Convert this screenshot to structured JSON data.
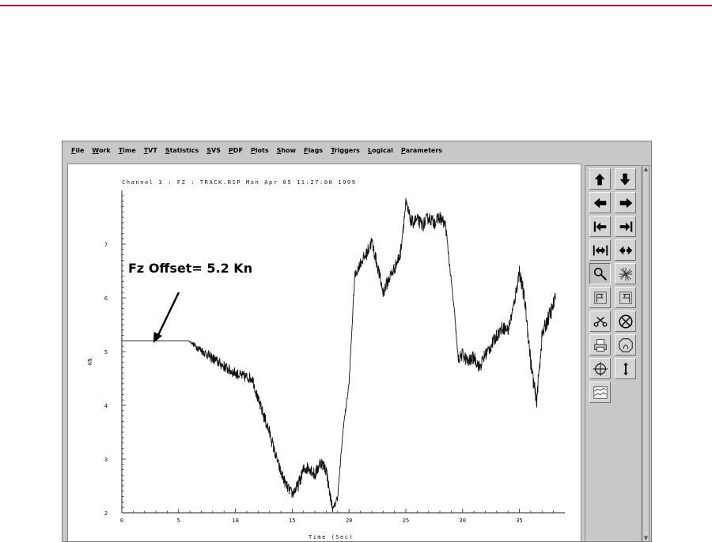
{
  "menu": {
    "items": [
      "File",
      "Work",
      "Time",
      "TVT",
      "Statistics",
      "SVS",
      "PDF",
      "Plots",
      "Show",
      "Flags",
      "Triggers",
      "Logical",
      "Parameters"
    ]
  },
  "plot": {
    "title": "Channel 3 : FZ : TRACK.RSP Mon Apr 05 11:27:00 1999",
    "annotation": "Fz Offset= 5.2 Kn",
    "xlabel": "Time (Sec)",
    "ylabel": "KN"
  },
  "chart_data": {
    "type": "line",
    "title": "Channel 3 : FZ : TRACK.RSP Mon Apr 05 11:27:00 1999",
    "xlabel": "Time (Sec)",
    "ylabel": "KN",
    "xlim": [
      0,
      39
    ],
    "ylim": [
      2,
      8
    ],
    "x_ticks": [
      "0",
      "5",
      "10",
      "15",
      "20",
      "25",
      "30",
      "35"
    ],
    "y_ticks": [
      "2",
      "3",
      "4",
      "5",
      "6",
      "7"
    ],
    "annotation": {
      "text": "Fz Offset= 5.2 Kn",
      "points_to": {
        "x": 1.8,
        "y": 5.2
      }
    },
    "series": [
      {
        "x": [
          0,
          2,
          4,
          5.9,
          6.5,
          7.5,
          8.5,
          9.5,
          10.5,
          11.5,
          12,
          12.5,
          13,
          13.5,
          14,
          14.5,
          15,
          15.5,
          16,
          16.5,
          17,
          17.5,
          18,
          18.3,
          18.6,
          19,
          19.5,
          20,
          20.5,
          21,
          21.5,
          22,
          22.5,
          23,
          23.5,
          24,
          24.5,
          25,
          25.5,
          26,
          26.5,
          27,
          27.5,
          28,
          28.5,
          29,
          29.3,
          29.6,
          30,
          30.5,
          31,
          31.5,
          32,
          32.5,
          33,
          33.5,
          34,
          34.5,
          35,
          35.5,
          36,
          36.5,
          37,
          37.4,
          37.8,
          38.2
        ],
        "y": [
          5.2,
          5.2,
          5.2,
          5.2,
          5.1,
          4.95,
          4.8,
          4.65,
          4.55,
          4.5,
          4.1,
          3.8,
          3.5,
          3.1,
          2.75,
          2.5,
          2.35,
          2.5,
          2.8,
          2.85,
          2.7,
          2.95,
          2.8,
          2.35,
          2.05,
          2.3,
          3.6,
          4.4,
          6.4,
          6.65,
          6.8,
          7.05,
          6.6,
          6.1,
          6.35,
          6.55,
          6.8,
          7.75,
          7.4,
          7.45,
          7.35,
          7.5,
          7.4,
          7.5,
          7.35,
          6.3,
          5.7,
          4.85,
          4.95,
          4.8,
          4.9,
          4.7,
          4.95,
          5.1,
          5.3,
          5.45,
          5.4,
          5.85,
          6.5,
          5.9,
          4.8,
          4.05,
          5.3,
          5.55,
          5.75,
          6.0
        ],
        "noise": [
          0,
          0,
          0,
          0,
          0.06,
          0.09,
          0.1,
          0.1,
          0.1,
          0.1,
          0.1,
          0.12,
          0.12,
          0.1,
          0.1,
          0.1,
          0.1,
          0.12,
          0.12,
          0.12,
          0.12,
          0.12,
          0.12,
          0.1,
          0.08,
          0.06,
          0.05,
          0.05,
          0.08,
          0.1,
          0.12,
          0.12,
          0.12,
          0.12,
          0.12,
          0.12,
          0.12,
          0.12,
          0.12,
          0.12,
          0.12,
          0.12,
          0.12,
          0.12,
          0.1,
          0.06,
          0.04,
          0.1,
          0.12,
          0.12,
          0.12,
          0.12,
          0.12,
          0.12,
          0.12,
          0.12,
          0.12,
          0.12,
          0.15,
          0.15,
          0.15,
          0.15,
          0.15,
          0.15,
          0.15,
          0.15
        ]
      }
    ]
  },
  "toolbar": {
    "buttons": [
      {
        "icon": "arrow-up-icon",
        "pressed": false
      },
      {
        "icon": "arrow-down-icon",
        "pressed": false
      },
      {
        "icon": "arrow-left-icon",
        "pressed": false
      },
      {
        "icon": "arrow-right-icon",
        "pressed": false
      },
      {
        "icon": "arrow-to-start-icon",
        "pressed": false
      },
      {
        "icon": "arrow-to-end-icon",
        "pressed": false
      },
      {
        "icon": "expand-horizontal-icon",
        "pressed": false
      },
      {
        "icon": "compress-horizontal-icon",
        "pressed": false
      },
      {
        "icon": "zoom-icon",
        "pressed": true
      },
      {
        "icon": "starburst-icon",
        "pressed": false
      },
      {
        "icon": "flag-left-icon",
        "pressed": false
      },
      {
        "icon": "flag-right-icon",
        "pressed": false
      },
      {
        "icon": "scissors-icon",
        "pressed": false
      },
      {
        "icon": "cancel-circle-icon",
        "pressed": false
      },
      {
        "icon": "printer-icon",
        "pressed": false
      },
      {
        "icon": "octagon-icon",
        "pressed": false
      },
      {
        "icon": "crosshair-icon",
        "pressed": false
      },
      {
        "icon": "vertical-arrows-icon",
        "pressed": false
      },
      {
        "icon": "overlay-plot-icon",
        "pressed": false
      }
    ]
  },
  "colors": {
    "accent_rule": "#a01f24",
    "trace": "#111111"
  }
}
